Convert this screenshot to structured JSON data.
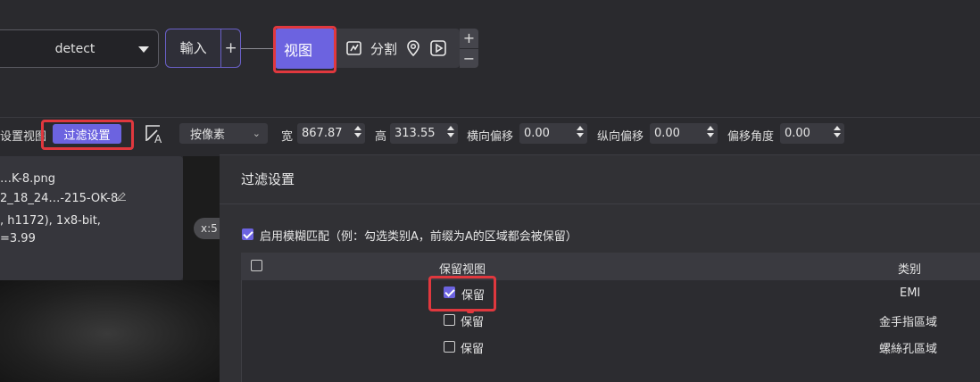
{
  "pipeline": {
    "detect_select": "detect",
    "input_node": "輸入",
    "input_plus": "+",
    "view_node": "视图",
    "split_label": "分割",
    "stepper_plus": "+",
    "stepper_minus": "−"
  },
  "toolbar": {
    "view_settings_partial": "设置视图",
    "filter_settings": "过滤设置",
    "unit_select": "按像素",
    "width_label": "宽",
    "width_value": "867.87",
    "height_label": "高",
    "height_value": "313.55",
    "h_offset_label": "横向偏移",
    "h_offset_value": "0.00",
    "v_offset_label": "纵向偏移",
    "v_offset_value": "0.00",
    "angle_label": "偏移角度",
    "angle_value": "0.00"
  },
  "info_panel": {
    "line1": "…K-8.png",
    "line2": "2_18_24…-215-OK-8",
    "line3": ", h1172), 1x8-bit,",
    "line4": "=3.99"
  },
  "canvas": {
    "x_badge": "x:5"
  },
  "dialog": {
    "title": "过滤设置",
    "fuzzy_label": "启用模糊匹配（例：勾选类别A，前缀为A的区域都会被保留）",
    "fuzzy_checked": true,
    "columns": [
      "保留视图",
      "类别"
    ],
    "rows": [
      {
        "keep": true,
        "keep_label": "保留",
        "category": "EMI"
      },
      {
        "keep": false,
        "keep_label": "保留",
        "category": "金手指區域"
      },
      {
        "keep": false,
        "keep_label": "保留",
        "category": "螺絲孔區域"
      }
    ]
  },
  "colors": {
    "accent": "#6c63e0",
    "highlight": "#e0383e",
    "background": "#2a2a2e"
  }
}
